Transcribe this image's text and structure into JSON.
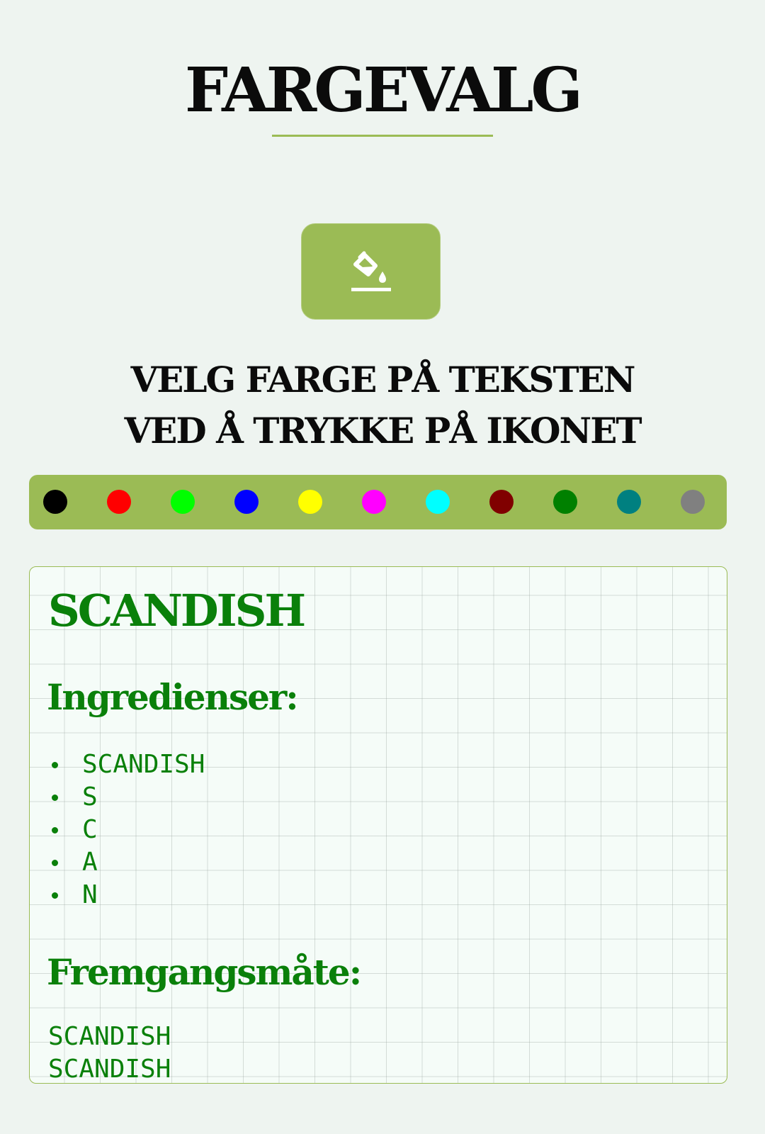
{
  "header": {
    "title": "FARGEVALG"
  },
  "paint_button": {
    "icon": "paint-bucket-icon",
    "icon_color": "#ffffff",
    "background": "#9bbb55"
  },
  "instructions": {
    "line1": "VELG FARGE PÅ TEKSTEN",
    "line2": "VED Å TRYKKE PÅ IKONET"
  },
  "palette": {
    "background": "#9bbb55",
    "colors": [
      {
        "name": "black",
        "hex": "#000000"
      },
      {
        "name": "red",
        "hex": "#ff0000"
      },
      {
        "name": "lime",
        "hex": "#00ff00"
      },
      {
        "name": "blue",
        "hex": "#0000ff"
      },
      {
        "name": "yellow",
        "hex": "#ffff00"
      },
      {
        "name": "magenta",
        "hex": "#ff00ff"
      },
      {
        "name": "cyan",
        "hex": "#00ffff"
      },
      {
        "name": "maroon",
        "hex": "#800000"
      },
      {
        "name": "green",
        "hex": "#008000"
      },
      {
        "name": "teal",
        "hex": "#008080"
      },
      {
        "name": "gray",
        "hex": "#808080"
      }
    ]
  },
  "recipe": {
    "text_color": "#0a800a",
    "title": "SCANDISH",
    "ingredients_heading": "Ingredienser:",
    "ingredients": [
      "SCANDISH",
      "S",
      "C",
      "A",
      "N"
    ],
    "method_heading": "Fremgangsmåte:",
    "method_lines": [
      "SCANDISH",
      "SCANDISH"
    ]
  }
}
